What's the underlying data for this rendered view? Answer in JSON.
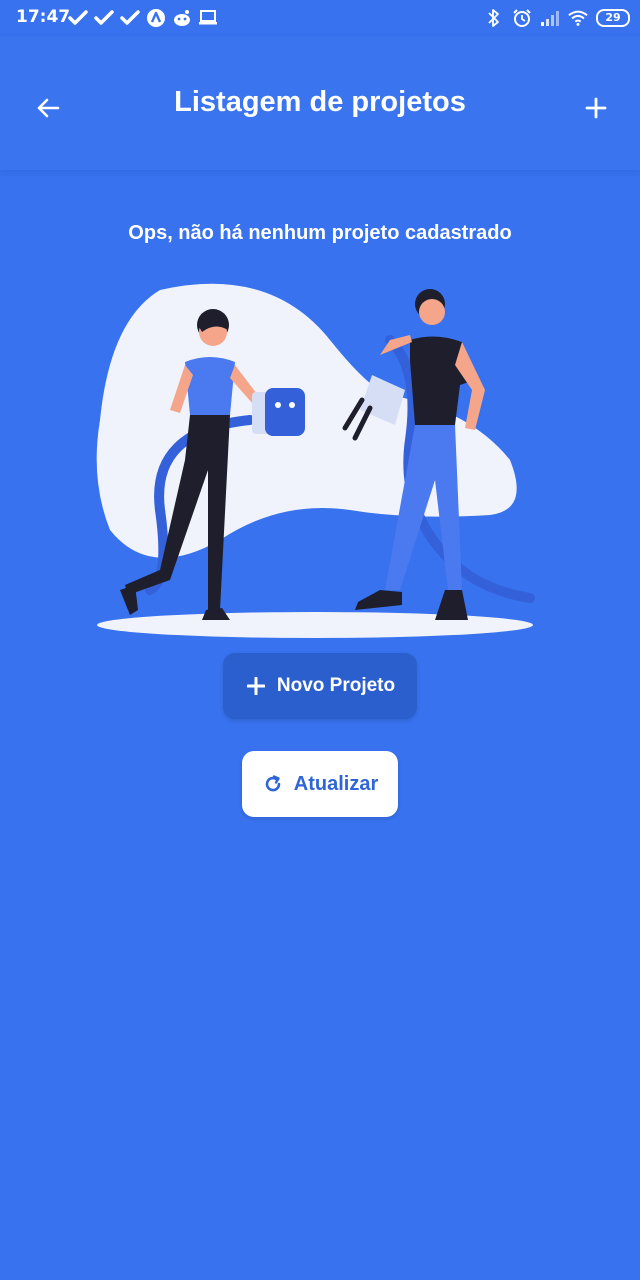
{
  "status_bar": {
    "time": "17:47",
    "battery": "29",
    "left_icons": [
      "check-icon",
      "check-icon",
      "check-icon",
      "app-a-icon",
      "reddit-icon",
      "laptop-icon"
    ],
    "right_icons": [
      "bluetooth-icon",
      "alarm-icon",
      "signal-icon",
      "wifi-icon",
      "battery-icon"
    ]
  },
  "app_bar": {
    "title": "Listagem de projetos",
    "back_icon": "arrow-left-icon",
    "add_icon": "plus-icon"
  },
  "empty_state": {
    "message": "Ops, não há nenhum projeto cadastrado",
    "illustration": "people-with-plugs-illustration"
  },
  "actions": {
    "new_project_label": "Novo Projeto",
    "new_project_icon": "plus-icon",
    "refresh_label": "Atualizar",
    "refresh_icon": "refresh-icon"
  },
  "colors": {
    "background": "#3872ee",
    "primary_dark": "#2c5fce",
    "white": "#ffffff",
    "text_on_white": "#2f65d6"
  }
}
